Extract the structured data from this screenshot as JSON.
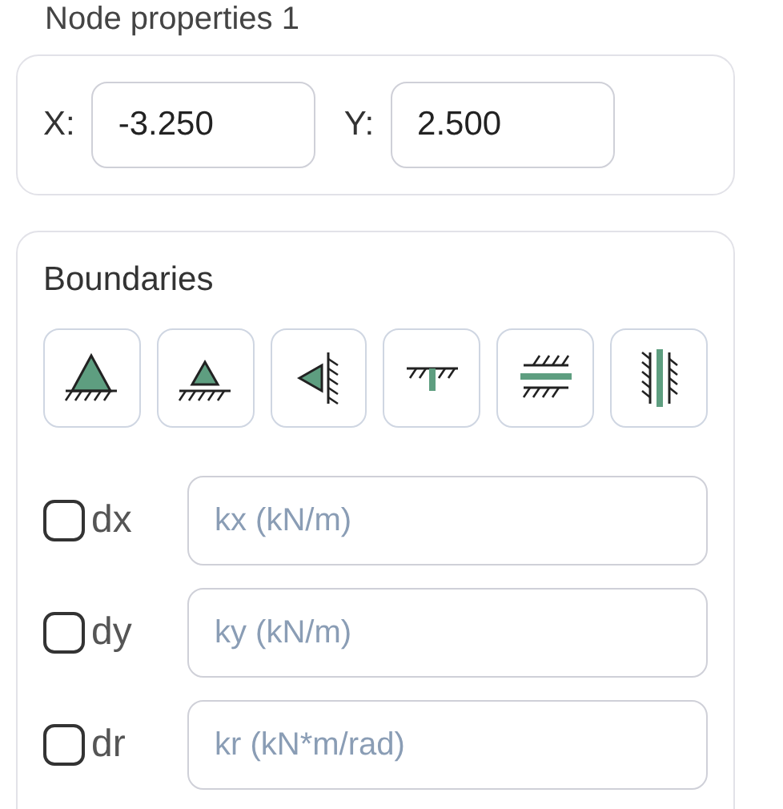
{
  "title": "Node properties 1",
  "coordinates": [
    {
      "label": "X:",
      "value": "-3.250"
    },
    {
      "label": "Y:",
      "value": "2.500"
    }
  ],
  "boundaries": {
    "title": "Boundaries",
    "supports": [
      {
        "kind": "pin"
      },
      {
        "kind": "pin-small"
      },
      {
        "kind": "wall-pin"
      },
      {
        "kind": "fixed-top"
      },
      {
        "kind": "slider-h"
      },
      {
        "kind": "slider-v"
      }
    ],
    "dofs": [
      {
        "label": "dx",
        "checked": false,
        "placeholder": "kx (kN/m)"
      },
      {
        "label": "dy",
        "checked": false,
        "placeholder": "ky (kN/m)"
      },
      {
        "label": "dr",
        "checked": false,
        "placeholder": "kr (kN*m/rad)"
      }
    ]
  }
}
